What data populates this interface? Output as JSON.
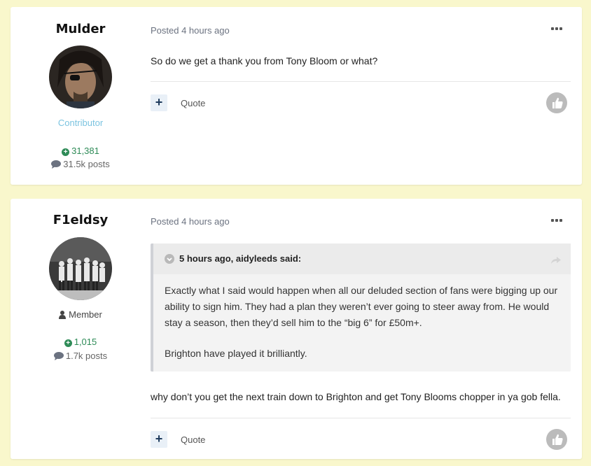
{
  "posts": [
    {
      "author": "Mulder",
      "rank": "Contributor",
      "reputation": "31,381",
      "post_count": "31.5k posts",
      "posted": "Posted 4 hours ago",
      "body": "So do we get a thank you from Tony Bloom or what?",
      "quote_label": "Quote"
    },
    {
      "author": "F1eldsy",
      "rank": "Member",
      "reputation": "1,015",
      "post_count": "1.7k posts",
      "posted": "Posted 4 hours ago",
      "quote": {
        "citation": "5 hours ago, aidyleeds said:",
        "paragraphs": [
          "Exactly what I said would happen when all our deluded section of fans were bigging up our ability to sign him. They had a plan they weren’t ever going to steer away from. He would stay a season, then they’d sell him to the “big 6” for £50m+.",
          "Brighton have played it brilliantly."
        ]
      },
      "body": "why don’t you get the next train down to Brighton and get Tony Blooms chopper in ya gob fella.",
      "quote_label": "Quote"
    }
  ],
  "icons": {
    "more": "ellipsis-icon",
    "add": "plus-icon",
    "like": "thumbs-up-icon",
    "reputation": "plus-circle-icon",
    "posts": "speech-bubble-icon",
    "member": "person-icon",
    "toggle": "chevron-down-icon",
    "share": "share-arrow-icon"
  },
  "colors": {
    "page_background": "#f9f7cc",
    "reputation": "#2e8b57",
    "contributor": "#7cc4e0"
  }
}
